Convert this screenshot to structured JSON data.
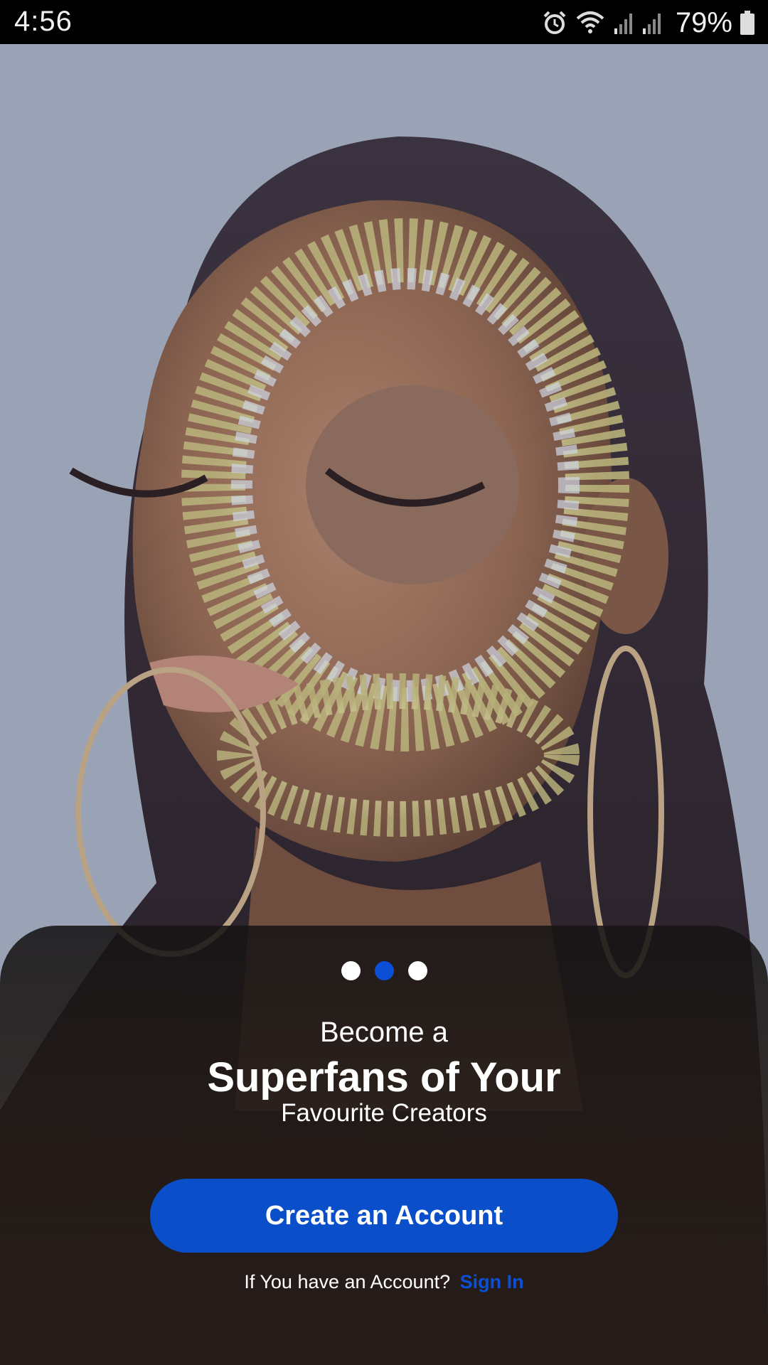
{
  "status_bar": {
    "time": "4:56",
    "battery_percent": "79%",
    "icons": [
      "alarm-icon",
      "wifi-icon",
      "signal-icon",
      "signal-icon",
      "battery-icon"
    ]
  },
  "onboarding": {
    "page_indicator": {
      "total": 3,
      "active_index": 1
    },
    "headline_small": "Become a",
    "headline_big": "Superfans of Your",
    "headline_sub": "Favourite Creators",
    "create_account_label": "Create an Account",
    "signin_prompt": "If You have an Account?",
    "signin_link": "Sign In"
  },
  "colors": {
    "accent": "#0a4fc9",
    "link": "#0a4fd6",
    "sheet": "#1e1816"
  }
}
